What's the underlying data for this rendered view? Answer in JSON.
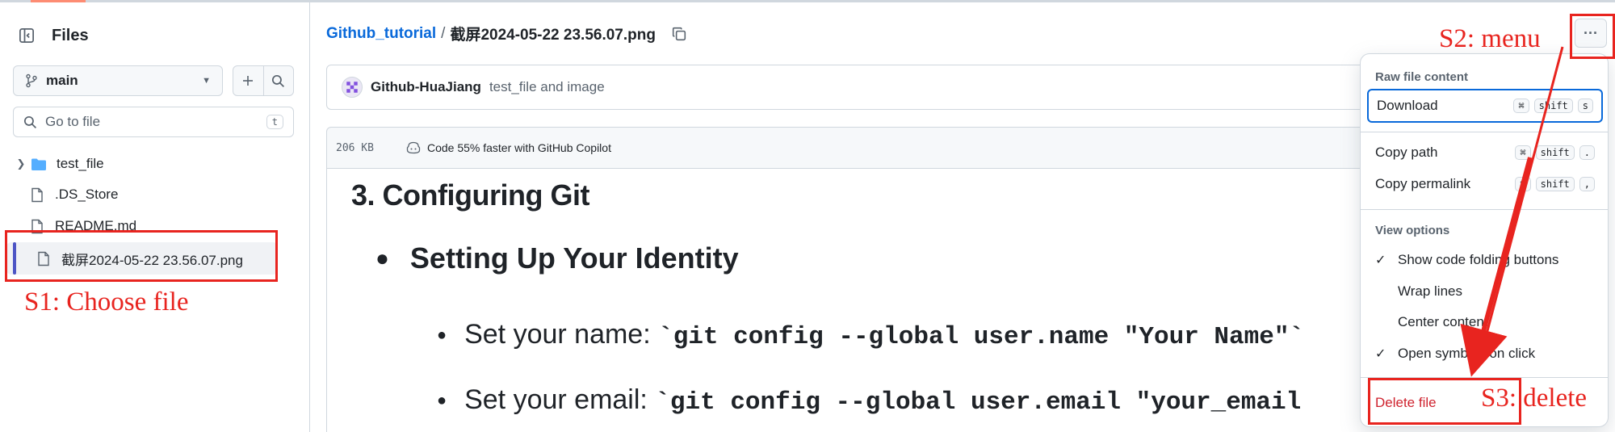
{
  "sidebar": {
    "title": "Files",
    "branch": "main",
    "goto_placeholder": "Go to file",
    "goto_shortcut": "t",
    "tree": [
      {
        "name": "test_file",
        "type": "folder"
      },
      {
        "name": ".DS_Store",
        "type": "file"
      },
      {
        "name": "README.md",
        "type": "file"
      },
      {
        "name": "截屏2024-05-22 23.56.07.png",
        "type": "file",
        "selected": true
      }
    ]
  },
  "breadcrumb": {
    "repo": "Github_tutorial",
    "separator": "/",
    "file": "截屏2024-05-22 23.56.07.png"
  },
  "commit": {
    "user": "Github-HuaJiang",
    "message": "test_file and image"
  },
  "file_header": {
    "size": "206 KB",
    "copilot": "Code 55% faster with GitHub Copilot"
  },
  "content": {
    "heading": "3. Configuring Git",
    "bullet": "Setting Up Your Identity",
    "sub_bullets": [
      {
        "label": "Set your name: ",
        "code": "`git config --global user.name \"Your Name\"`"
      },
      {
        "label": "Set your email: ",
        "code": "`git config --global user.email \"your_email"
      }
    ]
  },
  "menu": {
    "section_raw": "Raw file content",
    "download": "Download",
    "download_keys": [
      "⌘",
      "shift",
      "s"
    ],
    "copy_path": "Copy path",
    "copy_path_keys": [
      "⌘",
      "shift",
      "."
    ],
    "copy_permalink": "Copy permalink",
    "copy_permalink_keys": [
      "⌘",
      "shift",
      ","
    ],
    "section_view": "View options",
    "view_options": [
      {
        "label": "Show code folding buttons",
        "checked": true
      },
      {
        "label": "Wrap lines",
        "checked": false
      },
      {
        "label": "Center content",
        "checked": false
      },
      {
        "label": "Open symbols on click",
        "checked": true
      }
    ],
    "delete": "Delete file"
  },
  "annotations": {
    "s1": "S1: Choose file",
    "s2": "S2: menu",
    "s3": "S3: delete",
    "color": "#e8241f"
  },
  "colors": {
    "link": "#0969da",
    "danger": "#cf222e",
    "selection_bar": "#4d55c5",
    "folder": "#54aeff"
  }
}
